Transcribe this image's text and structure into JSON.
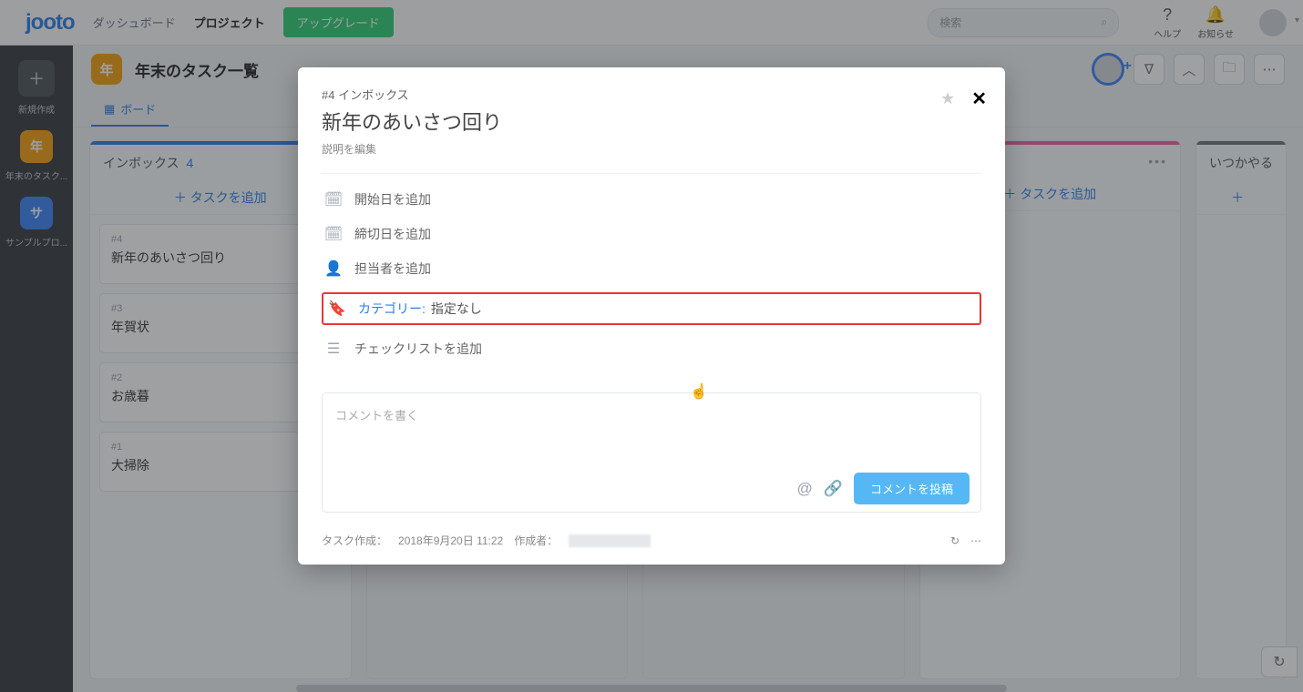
{
  "logo": "jooto",
  "nav": {
    "dashboard": "ダッシュボード",
    "project": "プロジェクト"
  },
  "upgrade": "アップグレード",
  "search_placeholder": "検索",
  "top_icons": {
    "help": "ヘルプ",
    "notice": "お知らせ"
  },
  "sidebar": {
    "new": "新規作成",
    "items": [
      {
        "icon": "年",
        "label": "年末のタスク..."
      },
      {
        "icon": "サ",
        "label": "サンプルプロ..."
      }
    ]
  },
  "project": {
    "icon": "年",
    "title": "年末のタスク一覧",
    "tab_board": "ボード"
  },
  "columns": [
    {
      "title": "インボックス",
      "count": "4",
      "bar": "#2b7de9",
      "add": "タスクを追加",
      "cards": [
        {
          "id": "#4",
          "title": "新年のあいさつ回り"
        },
        {
          "id": "#3",
          "title": "年賀状"
        },
        {
          "id": "#2",
          "title": "お歳暮"
        },
        {
          "id": "#1",
          "title": "大掃除"
        }
      ]
    },
    {
      "title": "",
      "bar": "#ef5da8",
      "add": "タスクを追加"
    },
    {
      "title": "いつかやる/多分",
      "bar": "#6b7280",
      "add": ""
    }
  ],
  "modal": {
    "breadcrumb": "#4 インボックス",
    "title": "新年のあいさつ回り",
    "desc_edit": "説明を編集",
    "details": {
      "start": "開始日を追加",
      "due": "締切日を追加",
      "assignee": "担当者を追加",
      "category_label": "カテゴリー:",
      "category_value": "指定なし",
      "checklist": "チェックリストを追加"
    },
    "comment_placeholder": "コメントを書く",
    "post_label": "コメントを投稿",
    "footer": {
      "created_label": "タスク作成：",
      "created_value": "2018年9月20日 11:22",
      "author_label": "作成者："
    }
  }
}
